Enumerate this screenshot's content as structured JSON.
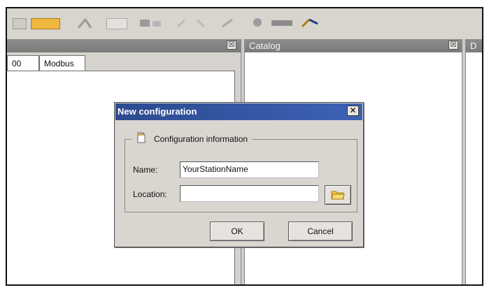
{
  "panels": {
    "left": {
      "tabs": [
        "00",
        "Modbus"
      ]
    },
    "catalog": {
      "title": "Catalog"
    },
    "right": {
      "title": "D"
    },
    "close_glyph": "☒"
  },
  "dialog": {
    "title": "New configuration",
    "close_glyph": "✕",
    "group_label": "Configuration information",
    "name_label": "Name:",
    "name_value": "YourStationName",
    "location_label": "Location:",
    "location_value": "",
    "ok_label": "OK",
    "cancel_label": "Cancel"
  },
  "icons": {
    "group": "document-icon",
    "browse": "folder-icon"
  },
  "colors": {
    "title_bar": "#2c4a8f",
    "panel_header": "#858585",
    "dialog_bg": "#d9d6d0"
  }
}
